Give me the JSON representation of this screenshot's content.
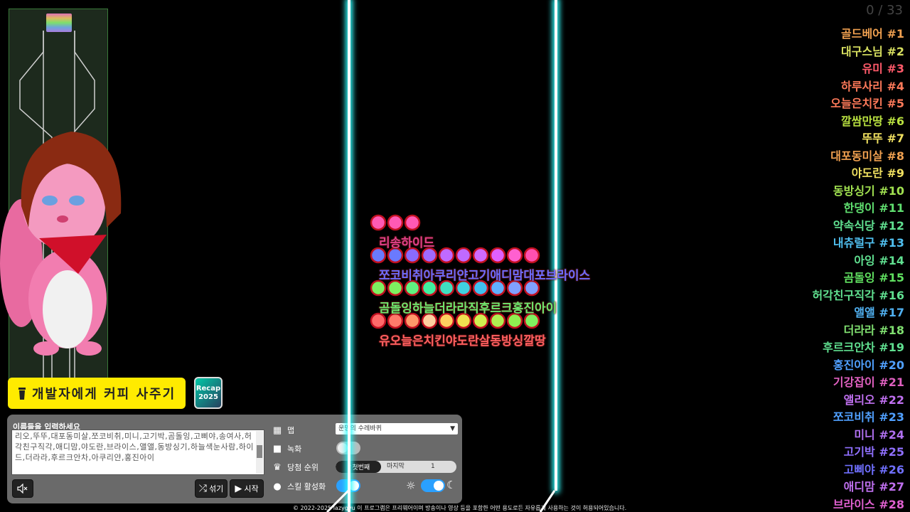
{
  "coffee_button": "개발자에게 커피 사주기",
  "recap": {
    "line1": "Recap",
    "line2": "2025"
  },
  "names_label": "이름들을 입력하세요",
  "names_value": "리오,뚜뚜,대포동미살,쪼코비취,미니,고기박,곰돌잉,고삐야,송여사,허각친구직각,애디맘,야도란,브라이스,앨앨,동방싱기,하늘색눈사람,하이드,더라라,후르크안차,아쿠리얀,홍진아이",
  "controls": {
    "map_label": "맵",
    "map_value": "운명의 수레바퀴",
    "record_label": "녹화",
    "rank_label": "당첨 순위",
    "rank_first": "✓첫번째",
    "rank_last": "마지막",
    "rank_number": "1",
    "skill_label": "스킬 활성화",
    "shuffle_label": "섞기",
    "start_label": "시작",
    "record_on": false,
    "skill_on": true,
    "theme_dark": true
  },
  "counter": "0 / 33",
  "board_labels": [
    {
      "text": "리송하이드",
      "color": "#e0408a"
    },
    {
      "text": "쪼코비취아쿠리얀고기애디맘대포브라이스",
      "color": "#6d6dff"
    },
    {
      "text": "곰돌잉하늘더라라직후르크홍진아이",
      "color": "#6ee86e"
    },
    {
      "text": "유오늘은치킨야도란살동방싱깔땅",
      "color": "#ff6060"
    }
  ],
  "rankings": [
    {
      "name": "골드베어 #1",
      "color": "#f0a050"
    },
    {
      "name": "대구스님 #2",
      "color": "#d8e060"
    },
    {
      "name": "유미 #3",
      "color": "#ff5a6a"
    },
    {
      "name": "하루사리 #4",
      "color": "#ff7a5a"
    },
    {
      "name": "오늘은치킨 #5",
      "color": "#ff7a5a"
    },
    {
      "name": "깔쌈만땅 #6",
      "color": "#b8e040"
    },
    {
      "name": "뚜뚜 #7",
      "color": "#f0e060"
    },
    {
      "name": "대포동미살 #8",
      "color": "#f0a050"
    },
    {
      "name": "야도란 #9",
      "color": "#f0e060"
    },
    {
      "name": "동방싱기 #10",
      "color": "#a0e050"
    },
    {
      "name": "한댕이 #11",
      "color": "#60e070"
    },
    {
      "name": "약속식당 #12",
      "color": "#60e090"
    },
    {
      "name": "내츄럴구 #13",
      "color": "#50c0f0"
    },
    {
      "name": "아잉 #14",
      "color": "#60e090"
    },
    {
      "name": "곰돌잉 #15",
      "color": "#60e060"
    },
    {
      "name": "허각친구직각 #16",
      "color": "#60e090"
    },
    {
      "name": "앨앨 #17",
      "color": "#50b0f0"
    },
    {
      "name": "더라라 #18",
      "color": "#80e070"
    },
    {
      "name": "후르크안차 #19",
      "color": "#60e090"
    },
    {
      "name": "홍진아이 #20",
      "color": "#50a0ff"
    },
    {
      "name": "기강잡이 #21",
      "color": "#e060c0"
    },
    {
      "name": "앨리오 #22",
      "color": "#c070f0"
    },
    {
      "name": "쪼코비취 #23",
      "color": "#50a0ff"
    },
    {
      "name": "미니 #24",
      "color": "#b070f0"
    },
    {
      "name": "고기박 #25",
      "color": "#9070ff"
    },
    {
      "name": "고삐야 #26",
      "color": "#7070ff"
    },
    {
      "name": "애디맘 #27",
      "color": "#c070f0"
    },
    {
      "name": "브라이스 #28",
      "color": "#e060d0"
    }
  ],
  "footer": "© 2022-2025 lazygyu 이 프로그램은 프리웨어이며 방송이나 영상 등을 포함한 어떤 용도로든 자유롭게 사용하는 것이 허용되어있습니다."
}
